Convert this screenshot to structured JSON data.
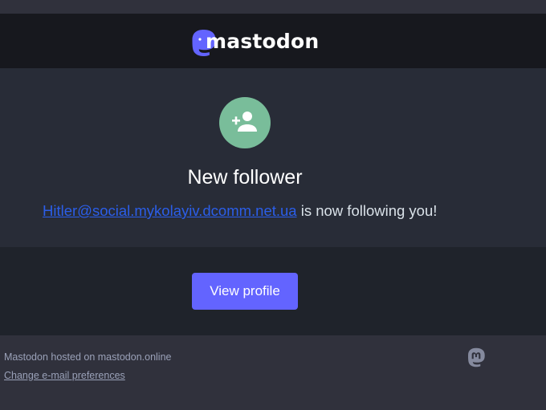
{
  "header": {
    "brand_name": "mastodon",
    "logo_icon": "mastodon-logo-icon"
  },
  "notification": {
    "icon": "person-add-icon",
    "icon_bg_color": "#79bd9a",
    "heading": "New follower",
    "follower_handle": "Hitler@social.mykolayiv.dcomm.net.ua",
    "message_suffix": " is now following you!"
  },
  "action": {
    "button_label": "View profile",
    "button_color": "#6364ff"
  },
  "footer": {
    "hosted_text": "Mastodon hosted on mastodon.online",
    "preferences_link": "Change e-mail preferences",
    "footer_icon": "mastodon-small-icon"
  }
}
